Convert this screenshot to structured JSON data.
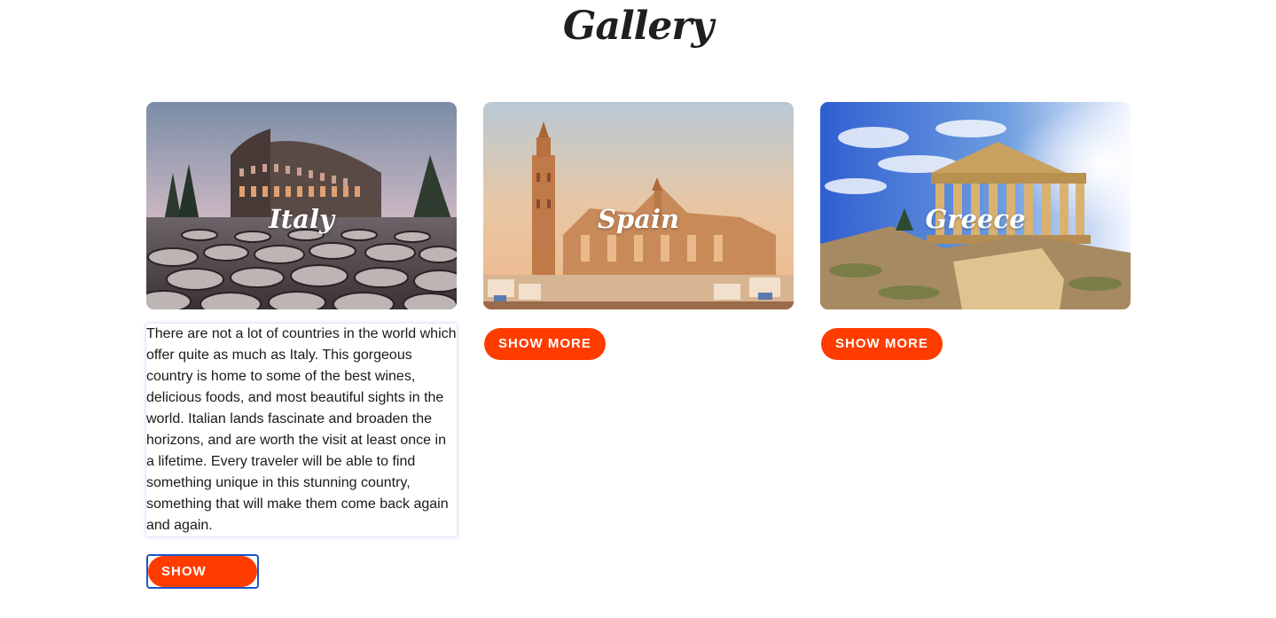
{
  "page": {
    "title": "Gallery"
  },
  "colors": {
    "button_bg": "#ff3c00",
    "button_text": "#ffffff",
    "focus_outline": "#1a56c8"
  },
  "cards": [
    {
      "label": "Italy",
      "image": "colosseum-photo",
      "expanded": true,
      "description": "There are not a lot of countries in the world which offer quite as much as Italy. This gorgeous country is home to some of the best wines, delicious foods, and most beautiful sights in the world. Italian lands fascinate and broaden the horizons, and are worth the visit at least once in a lifetime. Every traveler will be able to find something unique in this stunning country, something that will make them come back again and again.",
      "button_label": "SHOW LESS"
    },
    {
      "label": "Spain",
      "image": "seville-cathedral-photo",
      "expanded": false,
      "button_label": "SHOW MORE"
    },
    {
      "label": "Greece",
      "image": "parthenon-photo",
      "expanded": false,
      "button_label": "SHOW MORE"
    }
  ]
}
